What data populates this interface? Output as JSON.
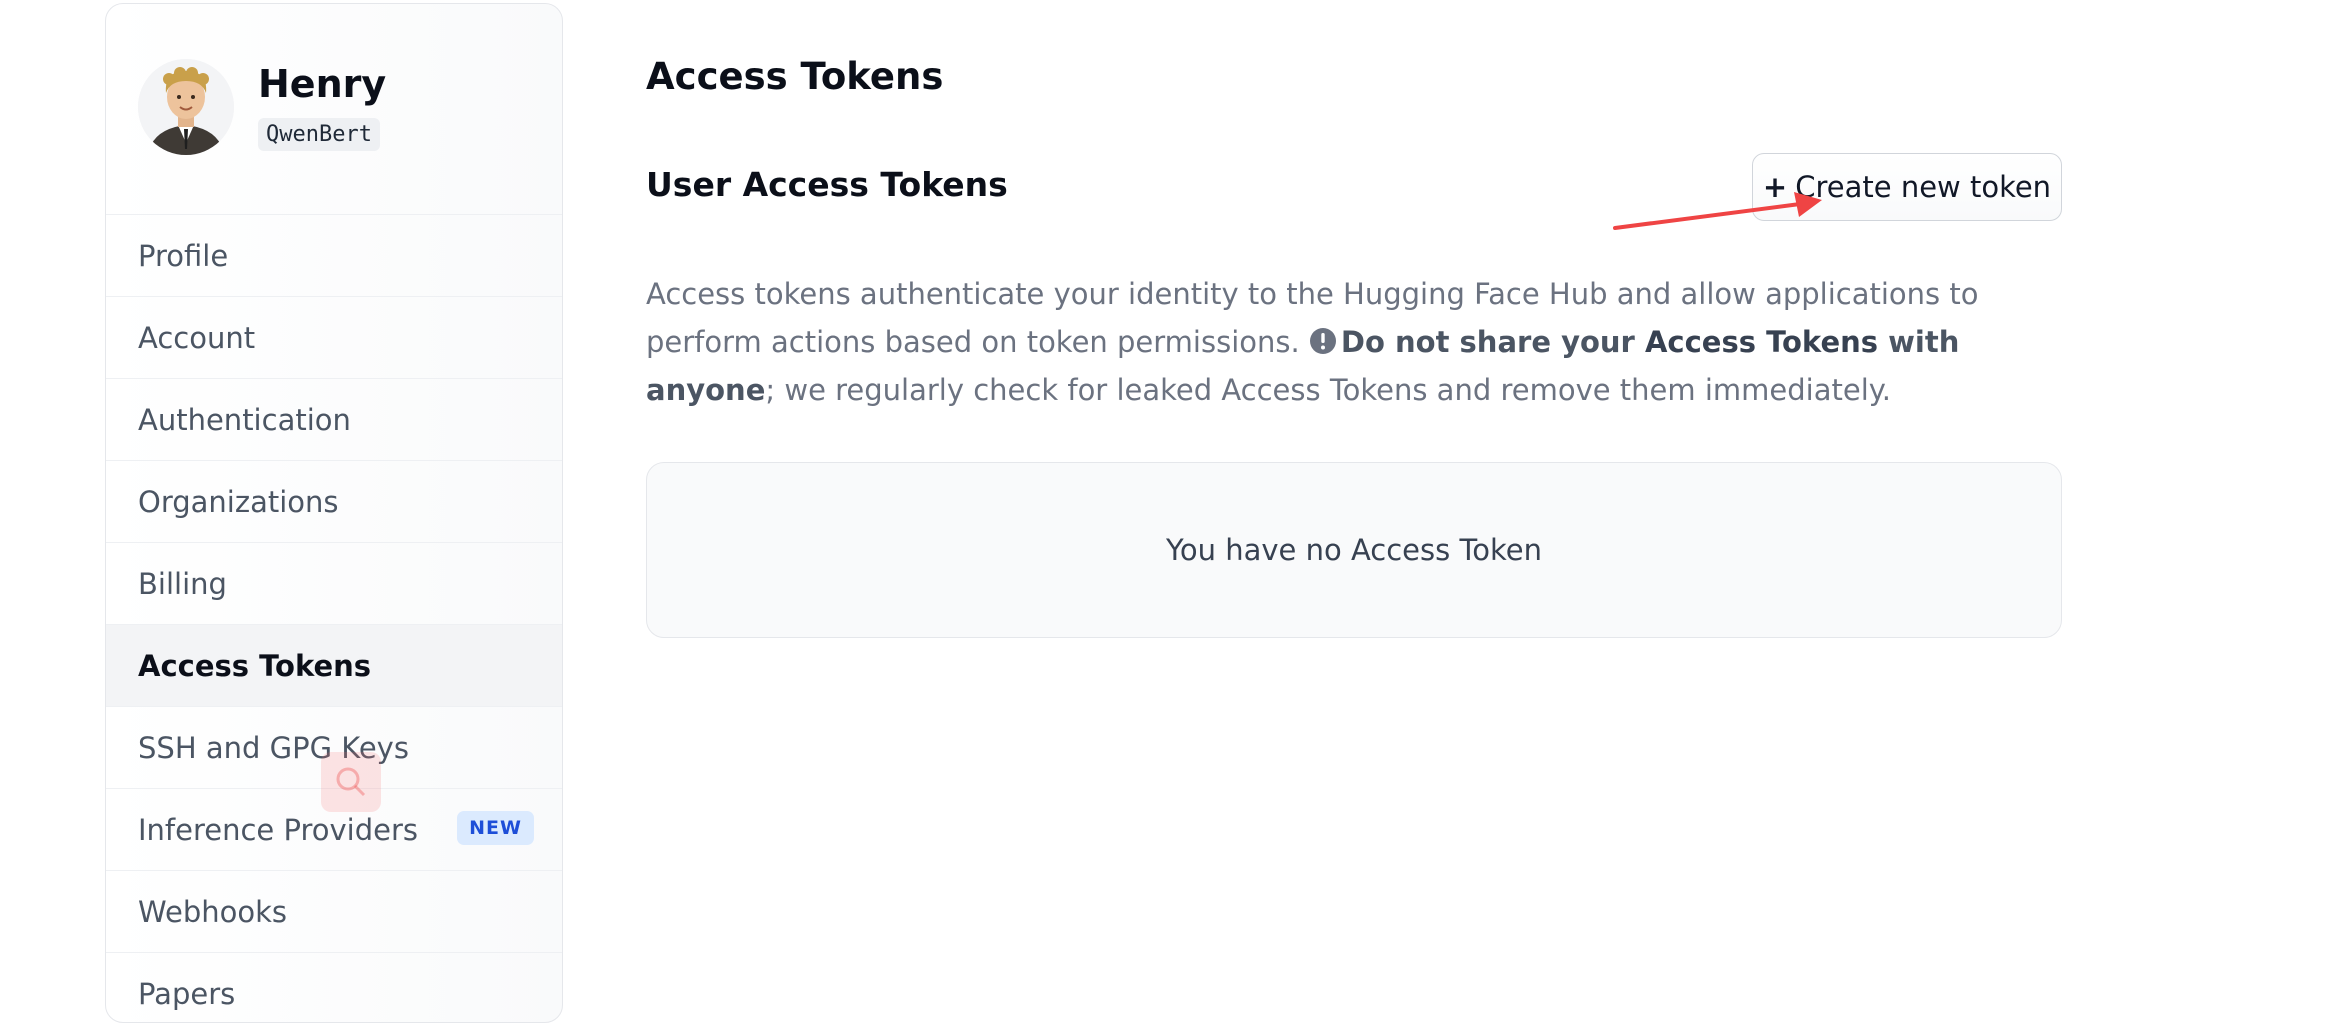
{
  "user": {
    "name": "Henry",
    "handle": "QwenBert"
  },
  "sidebar": {
    "items": [
      {
        "label": "Profile",
        "active": false
      },
      {
        "label": "Account",
        "active": false
      },
      {
        "label": "Authentication",
        "active": false
      },
      {
        "label": "Organizations",
        "active": false
      },
      {
        "label": "Billing",
        "active": false
      },
      {
        "label": "Access Tokens",
        "active": true
      },
      {
        "label": "SSH and GPG Keys",
        "active": false
      },
      {
        "label": "Inference Providers",
        "active": false,
        "badge": "NEW"
      },
      {
        "label": "Webhooks",
        "active": false
      },
      {
        "label": "Papers",
        "active": false
      }
    ]
  },
  "main": {
    "title": "Access Tokens",
    "section_title": "User Access Tokens",
    "create_button": {
      "plus": "+",
      "label": "Create new token"
    },
    "description": {
      "part1": "Access tokens authenticate your identity to the Hugging Face Hub and allow applications to perform actions based on token permissions. ",
      "warn_a": "Do not share your ",
      "warn_b": "Access Tokens",
      "warn_c": " with anyone",
      "part2": "; we regularly check for leaked Access Tokens and remove them immediately."
    },
    "empty_state": "You have no Access Token"
  },
  "colors": {
    "annotation_arrow": "#ef4444",
    "badge_bg": "#dbeafe",
    "badge_text": "#1d4ed8"
  }
}
